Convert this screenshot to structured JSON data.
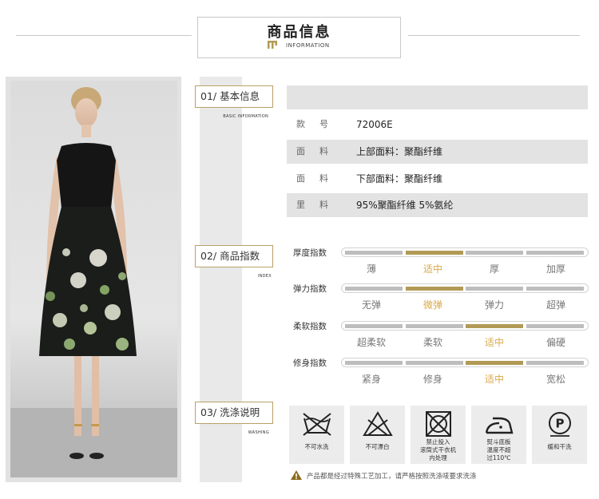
{
  "header": {
    "title": "商品信息",
    "subtitle": "INFORMATION"
  },
  "sections": [
    {
      "label": "01/ 基本信息",
      "sub": "BASIC INFORMATION"
    },
    {
      "label": "02/ 商品指数",
      "sub": "INDEX"
    },
    {
      "label": "03/ 洗涤说明",
      "sub": "WASHING"
    }
  ],
  "basic_info": [
    {
      "label": "款号",
      "value": "72006E"
    },
    {
      "label": "面料",
      "value": "上部面料：聚酯纤维"
    },
    {
      "label": "面料",
      "value": "下部面料：聚酯纤维"
    },
    {
      "label": "里料",
      "value": "95%聚酯纤维 5%氨纶"
    }
  ],
  "indices": [
    {
      "label": "厚度指数",
      "options": [
        "薄",
        "适中",
        "厚",
        "加厚"
      ],
      "selected": 1
    },
    {
      "label": "弹力指数",
      "options": [
        "无弹",
        "微弹",
        "弹力",
        "超弹"
      ],
      "selected": 1
    },
    {
      "label": "柔软指数",
      "options": [
        "超柔软",
        "柔软",
        "适中",
        "偏硬"
      ],
      "selected": 2
    },
    {
      "label": "修身指数",
      "options": [
        "紧身",
        "修身",
        "适中",
        "宽松"
      ],
      "selected": 2
    }
  ],
  "washing": [
    {
      "icon": "no-hand-wash-icon",
      "text": "不可水洗"
    },
    {
      "icon": "no-bleach-icon",
      "text": "不可漂白"
    },
    {
      "icon": "no-tumble-dry-icon",
      "text": "禁止投入\n滚筒式干衣机\n内处理"
    },
    {
      "icon": "iron-low-temp-icon",
      "text": "熨斗底板\n温度不超\n过110℃"
    },
    {
      "icon": "dry-clean-icon",
      "text": "缓和干洗"
    }
  ],
  "washing_note": "产品都是经过特殊工艺加工，请严格按照洗涤唛要求洗涤",
  "colors": {
    "accent": "#b19a56",
    "selected_text": "#d8a94a",
    "inactive_bar": "#bdbdbd"
  }
}
